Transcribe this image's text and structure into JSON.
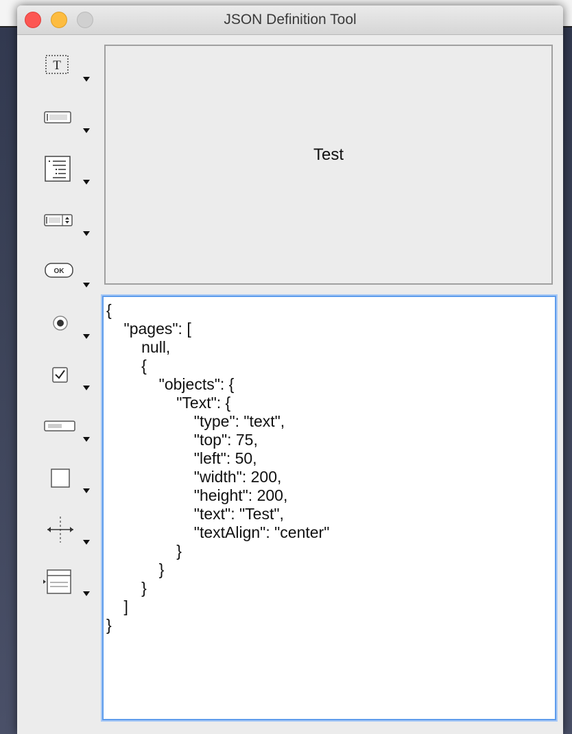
{
  "window": {
    "title": "JSON Definition Tool"
  },
  "toolbar": {
    "tools": [
      {
        "name": "text-field-tool",
        "icon": "text-field-icon"
      },
      {
        "name": "input-field-tool",
        "icon": "input-field-icon"
      },
      {
        "name": "list-tool",
        "icon": "list-icon"
      },
      {
        "name": "stepper-field-tool",
        "icon": "stepper-field-icon"
      },
      {
        "name": "button-tool",
        "icon": "ok-button-icon",
        "label": "OK"
      },
      {
        "name": "radio-button-tool",
        "icon": "radio-button-icon"
      },
      {
        "name": "checkbox-tool",
        "icon": "checkbox-icon"
      },
      {
        "name": "slider-tool",
        "icon": "slider-icon"
      },
      {
        "name": "box-tool",
        "icon": "box-icon"
      },
      {
        "name": "separator-tool",
        "icon": "separator-icon"
      },
      {
        "name": "panel-tool",
        "icon": "panel-icon"
      }
    ]
  },
  "preview": {
    "text": "Test"
  },
  "editor": {
    "content": "{\n    \"pages\": [\n        null,\n        {\n            \"objects\": {\n                \"Text\": {\n                    \"type\": \"text\",\n                    \"top\": 75,\n                    \"left\": 50,\n                    \"width\": 200,\n                    \"height\": 200,\n                    \"text\": \"Test\",\n                    \"textAlign\": \"center\"\n                }\n            }\n        }\n    ]\n}"
  },
  "colors": {
    "close": "#fc5753",
    "minimize": "#fdbc40",
    "zoom": "#d0d0d0",
    "editor_focus": "#5d9cec"
  }
}
